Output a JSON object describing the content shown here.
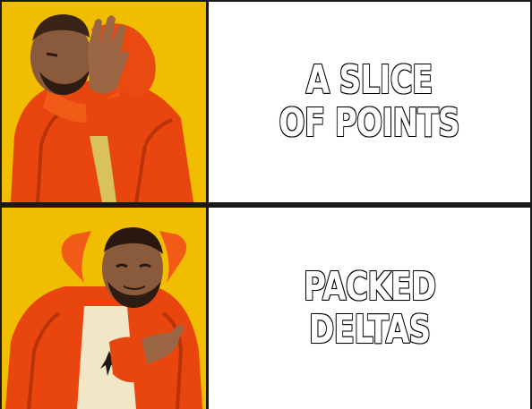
{
  "panels": [
    {
      "caption": "A SLICE\nOF POINTS",
      "reaction": "disapproving"
    },
    {
      "caption": "PACKED\nDELTAS",
      "reaction": "approving"
    }
  ],
  "colors": {
    "background_yellow": "#f2c200",
    "jacket_orange": "#e8400c",
    "border": "#1a1a1a",
    "caption_fill": "#ffffff",
    "caption_stroke": "#000000"
  }
}
